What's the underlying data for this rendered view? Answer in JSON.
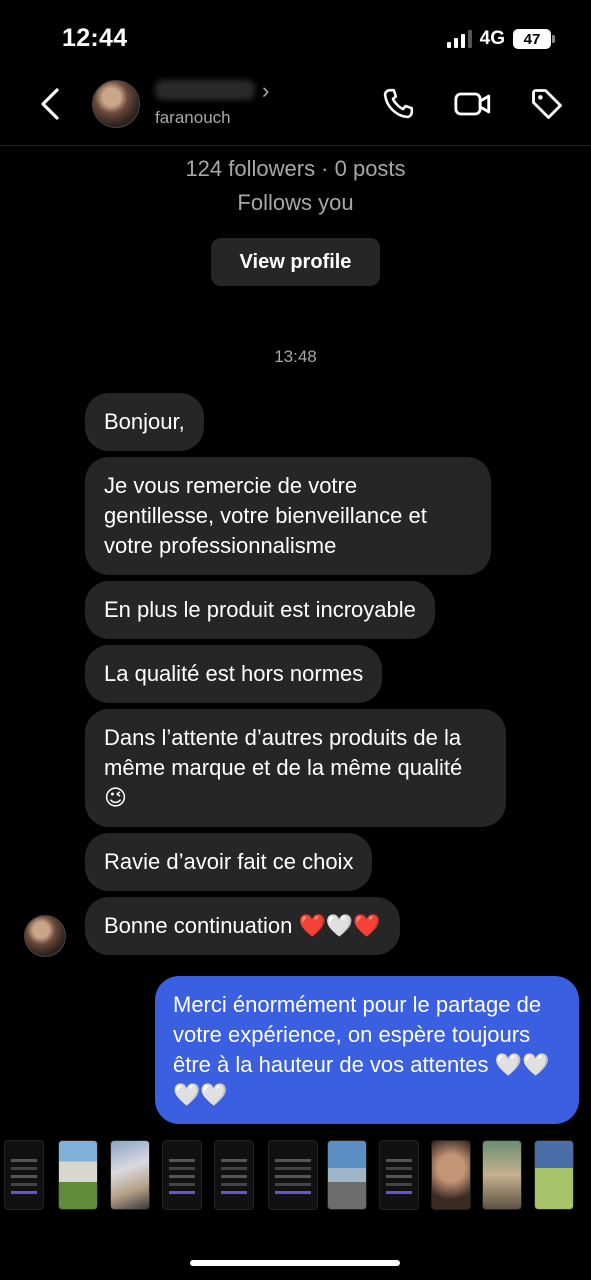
{
  "status_bar": {
    "time": "12:44",
    "network": "4G",
    "battery": "47"
  },
  "header": {
    "username": "faranouch"
  },
  "profile": {
    "followers_line": "124 followers · 0 posts",
    "follows_you": "Follows you",
    "view_profile_label": "View profile"
  },
  "timestamp": "13:48",
  "received_messages": [
    "Bonjour,",
    "Je vous remercie de votre gentillesse, votre bienveillance et votre professionnalisme",
    "En plus le produit est incroyable",
    "La qualité est hors normes",
    "Dans l’attente d’autres produits de la même marque et de la même qualité 😉",
    "Ravie d’avoir fait ce choix",
    "Bonne continuation ❤️🤍❤️"
  ],
  "sent_messages": [
    "Merci énormément pour le partage de votre expérience, on espère toujours être à la hauteur de vos attentes 🤍🤍🤍🤍"
  ],
  "icons": {
    "back": "chevron-left-icon",
    "phone": "phone-icon",
    "video": "video-camera-icon",
    "tag": "tag-icon"
  },
  "colors": {
    "background": "#000000",
    "received_bubble": "#262626",
    "sent_bubble": "#3a5fe0",
    "secondary_text": "#a8a8a8"
  }
}
